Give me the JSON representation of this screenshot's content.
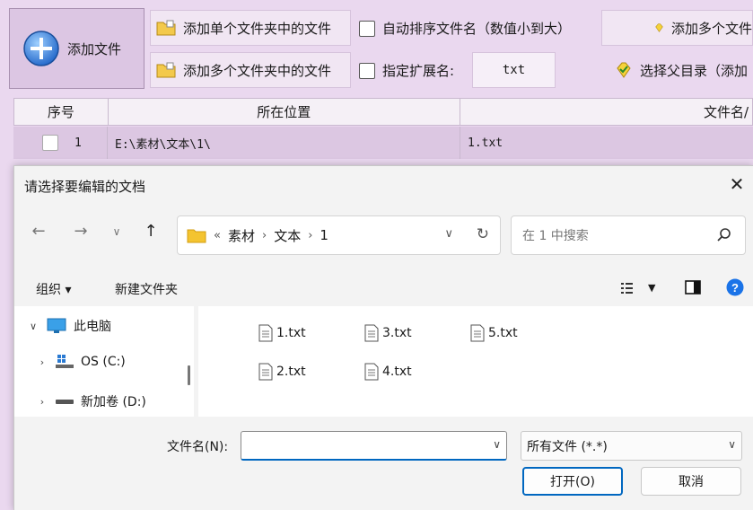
{
  "toolbar": {
    "add_file": "添加文件",
    "add_single_folder": "添加单个文件夹中的文件",
    "add_multi_folder": "添加多个文件夹中的文件",
    "auto_sort": "自动排序文件名（数值小到大）",
    "specify_ext": "指定扩展名:",
    "ext_value": "txt",
    "add_multi_right": "添加多个文件",
    "select_parent": "选择父目录（添加"
  },
  "table": {
    "headers": [
      "序号",
      "所在位置",
      "文件名/"
    ],
    "row": {
      "index": "1",
      "location": "E:\\素材\\文本\\1\\",
      "filename": "1.txt"
    }
  },
  "dialog": {
    "title": "请选择要编辑的文档",
    "close": "✕",
    "address": {
      "overflow": "«",
      "crumbs": [
        "素材",
        "文本",
        "1"
      ]
    },
    "search_placeholder": "在 1 中搜索",
    "organize": "组织 ▾",
    "new_folder": "新建文件夹",
    "tree": [
      {
        "label": "此电脑",
        "expanded": true
      },
      {
        "label": "OS (C:)",
        "expanded": false
      },
      {
        "label": "新加卷 (D:)",
        "expanded": false
      }
    ],
    "files": [
      "1.txt",
      "3.txt",
      "5.txt",
      "2.txt",
      "4.txt"
    ],
    "filename_label": "文件名(N):",
    "filename_value": "",
    "filetype_value": "所有文件 (*.*)",
    "open_label": "打开(O)",
    "cancel_label": "取消"
  },
  "colors": {
    "accent": "#0067c0",
    "app_bg": "#ead8ef",
    "row_highlight": "#dcc7e2"
  }
}
